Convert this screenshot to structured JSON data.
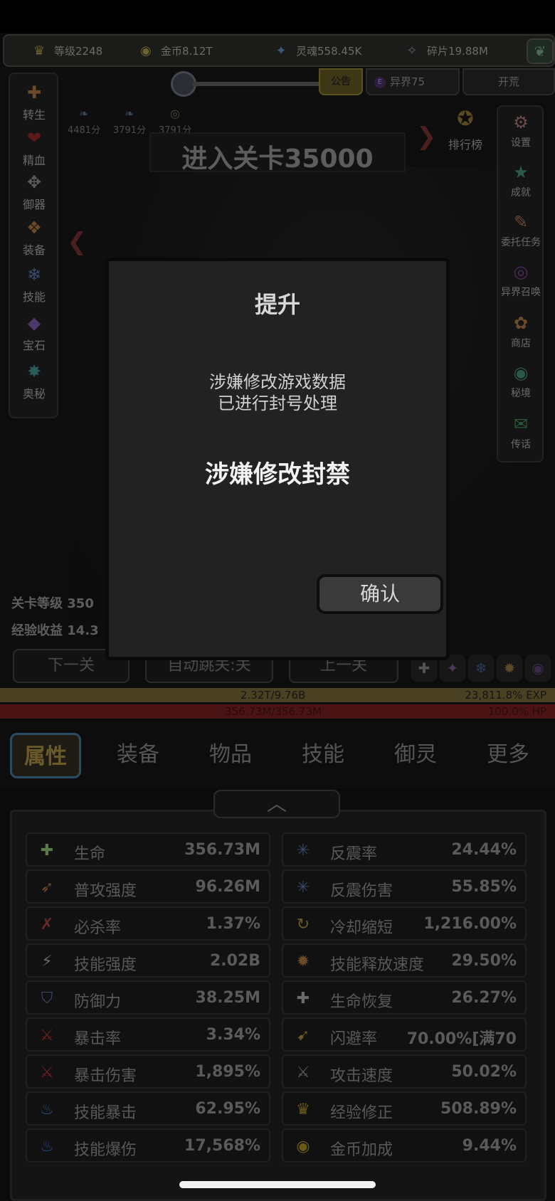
{
  "resources": [
    {
      "label": "等级2248",
      "icon": "crown-icon",
      "glyph": "♛"
    },
    {
      "label": "金币8.12T",
      "icon": "coin-icon",
      "glyph": "◉"
    },
    {
      "label": "灵魂558.45K",
      "icon": "soul-icon",
      "glyph": "✦"
    },
    {
      "label": "碎片19.88M",
      "icon": "fragment-icon",
      "glyph": "✧"
    }
  ],
  "tabs": {
    "notice": "公告",
    "otherworld": "异界75",
    "otherworld_badge": "E",
    "kaihuang": "开荒"
  },
  "left_menu": [
    {
      "label": "转生",
      "glyph": "✚",
      "color": "#6b4a2a"
    },
    {
      "label": "精血",
      "glyph": "❤",
      "color": "#5a1a1a"
    },
    {
      "label": "御器",
      "glyph": "✥",
      "color": "#5a5a5a"
    },
    {
      "label": "装备",
      "glyph": "❖",
      "color": "#6a4a2a"
    },
    {
      "label": "技能",
      "glyph": "❄",
      "color": "#3a4a6a"
    },
    {
      "label": "宝石",
      "glyph": "◆",
      "color": "#4a3a6a"
    },
    {
      "label": "奥秘",
      "glyph": "✸",
      "color": "#2a5a5a"
    }
  ],
  "right_menu": [
    {
      "label": "设置",
      "glyph": "⚙",
      "color": "#6a4a4a"
    },
    {
      "label": "成就",
      "glyph": "★",
      "color": "#2a5a4a"
    },
    {
      "label": "委托任务",
      "glyph": "✎",
      "color": "#6a4a3a"
    },
    {
      "label": "异界召唤",
      "glyph": "◎",
      "color": "#4a2a5a"
    },
    {
      "label": "商店",
      "glyph": "✿",
      "color": "#6a4a2a"
    },
    {
      "label": "秘境",
      "glyph": "◉",
      "color": "#2a5a4a"
    },
    {
      "label": "传话",
      "glyph": "✉",
      "color": "#2a5a3a"
    }
  ],
  "scores": [
    "4481分",
    "3791分",
    "3791分"
  ],
  "level_banner": "进入关卡35000",
  "rank_label": "排行榜",
  "info": {
    "stage_level": "关卡等级 350",
    "exp_gain": "经验收益 14.3"
  },
  "nav": {
    "next": "下一关",
    "auto": "自动跳关:关",
    "prev": "上一关"
  },
  "exp_bar": {
    "left": "2.32T/9.76B",
    "right": "23,811.8% EXP",
    "fill": 1.0
  },
  "hp_bar": {
    "left": "356.73M/356.73M",
    "right": "100.0%  HP",
    "fill": 1.0
  },
  "bottom_tabs": [
    "属性",
    "装备",
    "物品",
    "技能",
    "御灵",
    "更多"
  ],
  "collapse_glyph": "︿",
  "stats_left": [
    {
      "name": "生命",
      "value": "356.73M",
      "icon": "life-icon",
      "glyph": "✚",
      "color": "#5a7a4a"
    },
    {
      "name": "普攻强度",
      "value": "96.26M",
      "icon": "sword-icon",
      "glyph": "➶",
      "color": "#6a4a2a"
    },
    {
      "name": "必杀率",
      "value": "1.37%",
      "icon": "crit-icon",
      "glyph": "✗",
      "color": "#6a2a2a"
    },
    {
      "name": "技能强度",
      "value": "2.02B",
      "icon": "lightning-icon",
      "glyph": "⚡",
      "color": "#6a6a6a"
    },
    {
      "name": "防御力",
      "value": "38.25M",
      "icon": "shield-icon",
      "glyph": "⛉",
      "color": "#3a4a6a"
    },
    {
      "name": "暴击率",
      "value": "3.34%",
      "icon": "claw-icon",
      "glyph": "⚔",
      "color": "#6a2020"
    },
    {
      "name": "暴击伤害",
      "value": "1,895%",
      "icon": "claw-icon",
      "glyph": "⚔",
      "color": "#6a2020"
    },
    {
      "name": "技能暴击",
      "value": "62.95%",
      "icon": "blue-flame-icon",
      "glyph": "♨",
      "color": "#2a4a7a"
    },
    {
      "name": "技能爆伤",
      "value": "17,568%",
      "icon": "blue-flame-icon",
      "glyph": "♨",
      "color": "#2a4a7a"
    }
  ],
  "stats_right": [
    {
      "name": "反震率",
      "value": "24.44%",
      "icon": "reflect-icon",
      "glyph": "✳",
      "color": "#3a4a6a"
    },
    {
      "name": "反震伤害",
      "value": "55.85%",
      "icon": "reflect-icon",
      "glyph": "✳",
      "color": "#3a4a6a"
    },
    {
      "name": "冷却缩短",
      "value": "1,216.00%",
      "icon": "cooldown-icon",
      "glyph": "↻",
      "color": "#6a5a2a"
    },
    {
      "name": "技能释放速度",
      "value": "29.50%",
      "icon": "cast-speed-icon",
      "glyph": "✹",
      "color": "#6a4a2a"
    },
    {
      "name": "生命恢复",
      "value": "26.27%",
      "icon": "regen-icon",
      "glyph": "✚",
      "color": "#6a6a6a"
    },
    {
      "name": "闪避率",
      "value": "70.00%[满70",
      "icon": "boot-icon",
      "glyph": "➹",
      "color": "#6a5a2a"
    },
    {
      "name": "攻击速度",
      "value": "50.02%",
      "icon": "attack-speed-icon",
      "glyph": "⚔",
      "color": "#5a5a5a"
    },
    {
      "name": "经验修正",
      "value": "508.89%",
      "icon": "exp-crown-icon",
      "glyph": "♛",
      "color": "#6a5a1a"
    },
    {
      "name": "金币加成",
      "value": "9.44%",
      "icon": "gold-coin-icon",
      "glyph": "◉",
      "color": "#6a5a1a"
    }
  ],
  "dialog": {
    "title": "提升",
    "message_line1": "涉嫌修改游戏数据",
    "message_line2": "已进行封号处理",
    "ban_text": "涉嫌修改封禁",
    "confirm": "确认"
  }
}
